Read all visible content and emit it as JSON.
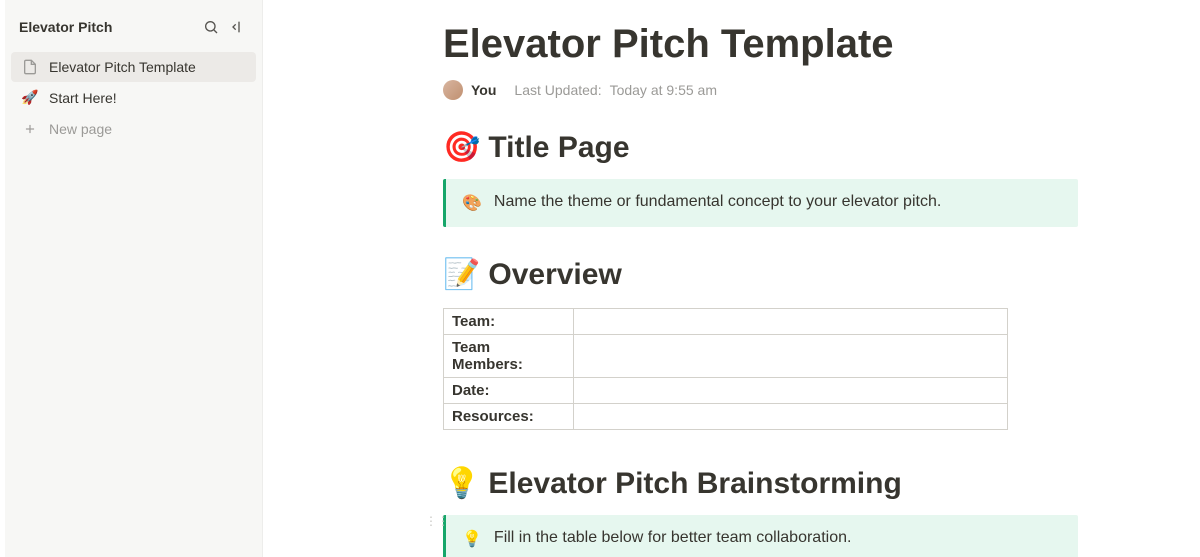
{
  "workspace": {
    "title": "Elevator Pitch"
  },
  "sidebar": {
    "items": [
      {
        "icon": "📄",
        "label": "Elevator Pitch Template",
        "active": true
      },
      {
        "icon": "🚀",
        "label": "Start Here!",
        "active": false
      }
    ],
    "new_page_label": "New page"
  },
  "page": {
    "title": "Elevator Pitch Template",
    "author": "You",
    "last_updated_label": "Last Updated:",
    "last_updated_value": "Today at 9:55 am"
  },
  "section_title_page": {
    "emoji": "🎯",
    "heading": "Title Page",
    "callout_icon": "🎨",
    "callout_text": "Name the theme or fundamental concept to your elevator pitch."
  },
  "section_overview": {
    "emoji": "📝",
    "heading": "Overview",
    "rows": [
      {
        "label": "Team:",
        "value": ""
      },
      {
        "label": "Team Members:",
        "value": ""
      },
      {
        "label": "Date:",
        "value": ""
      },
      {
        "label": "Resources:",
        "value": ""
      }
    ]
  },
  "section_brainstorm": {
    "emoji": "💡",
    "heading": "Elevator Pitch Brainstorming",
    "callout_icon": "💡",
    "callout_text": "Fill in the table below for better team collaboration."
  }
}
